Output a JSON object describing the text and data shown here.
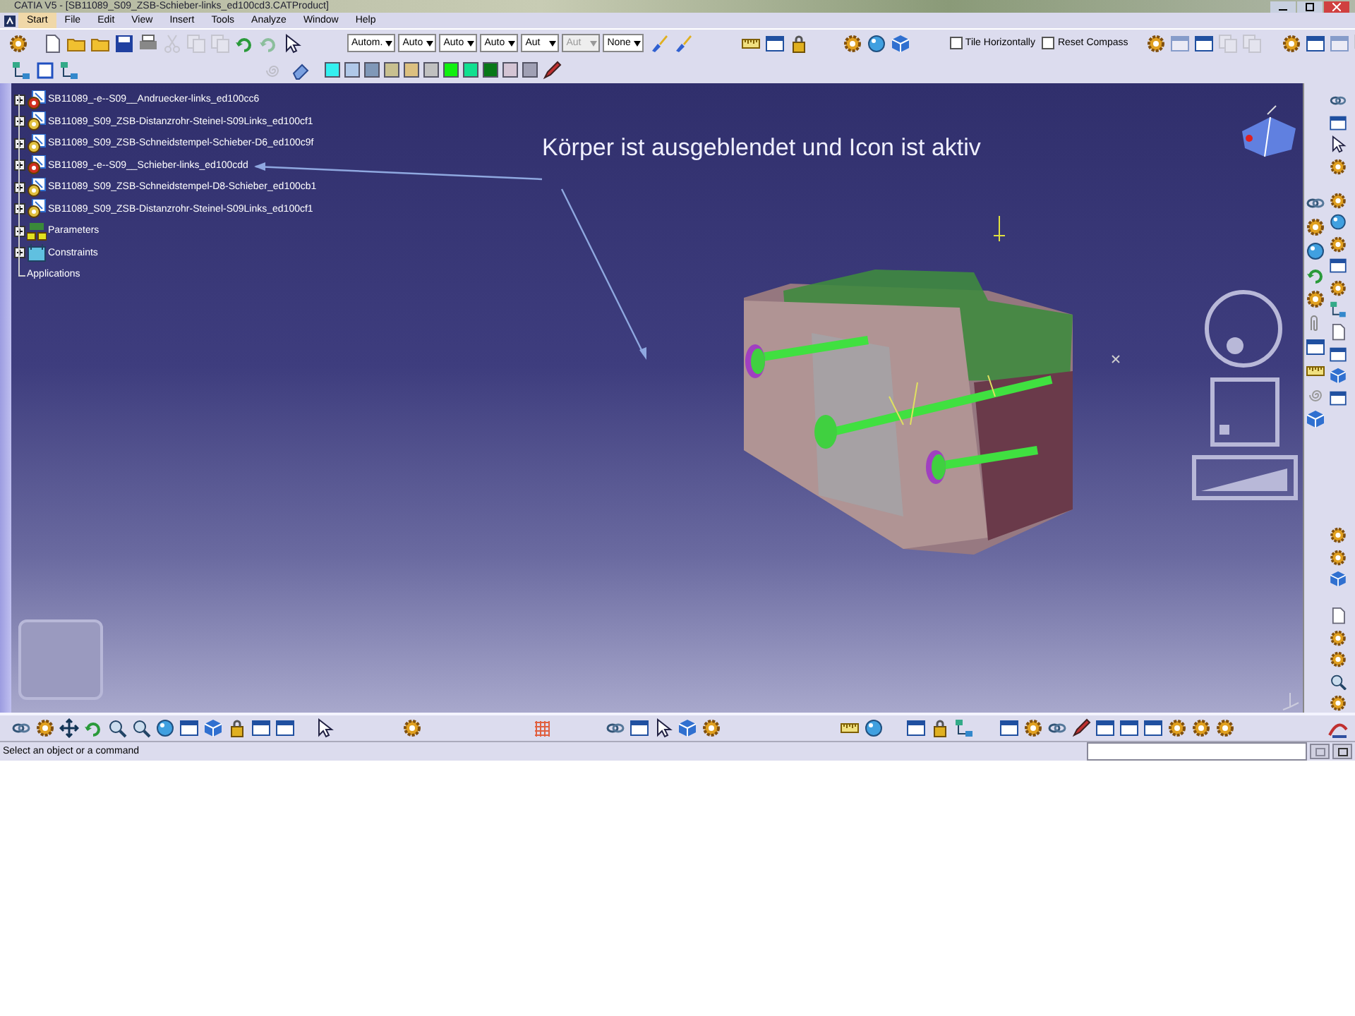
{
  "window": {
    "title": "CATIA V5 - [SB11089_S09_ZSB-Schieber-links_ed100cd3.CATProduct]"
  },
  "menu": [
    {
      "label": "Start",
      "selected": true
    },
    {
      "label": "File",
      "selected": false
    },
    {
      "label": "Edit",
      "selected": false
    },
    {
      "label": "View",
      "selected": false
    },
    {
      "label": "Insert",
      "selected": false
    },
    {
      "label": "Tools",
      "selected": false
    },
    {
      "label": "Analyze",
      "selected": false
    },
    {
      "label": "Window",
      "selected": false
    },
    {
      "label": "Help",
      "selected": false
    }
  ],
  "toolbar": {
    "dropdowns": [
      {
        "value": "Autom.",
        "disabled": false
      },
      {
        "value": "Auto",
        "disabled": false
      },
      {
        "value": "Auto",
        "disabled": false
      },
      {
        "value": "Auto",
        "disabled": false
      },
      {
        "value": "Aut",
        "disabled": false
      },
      {
        "value": "Aut",
        "disabled": true
      },
      {
        "value": "None",
        "disabled": false
      }
    ],
    "checkboxes": [
      {
        "label": "Tile Horizontally",
        "checked": false
      },
      {
        "label": "Reset Compass",
        "checked": false
      }
    ],
    "swatches": [
      {
        "color": "#33f0f0"
      },
      {
        "color": "#b0c8e8"
      },
      {
        "color": "#8098b8"
      },
      {
        "color": "#c8c090"
      },
      {
        "color": "#dcc080"
      },
      {
        "color": "#c0c0c0"
      },
      {
        "color": "#10f010"
      },
      {
        "color": "#10e090"
      },
      {
        "color": "#087818"
      },
      {
        "color": "#d4c4d4"
      },
      {
        "color": "#a0a0b4"
      }
    ]
  },
  "tree": {
    "items": [
      {
        "label": "SB11089_-e--S09__Andruecker-links_ed100cc6",
        "kind": "part",
        "expanded": false,
        "active": true
      },
      {
        "label": "SB11089_S09_ZSB-Distanzrohr-Steinel-S09Links_ed100cf1",
        "kind": "part",
        "expanded": false,
        "active": false
      },
      {
        "label": "SB11089_S09_ZSB-Schneidstempel-Schieber-D6_ed100c9f",
        "kind": "part",
        "expanded": false,
        "active": false
      },
      {
        "label": "SB11089_-e--S09__Schieber-links_ed100cdd",
        "kind": "part",
        "expanded": false,
        "active": true
      },
      {
        "label": "SB11089_S09_ZSB-Schneidstempel-D8-Schieber_ed100cb1",
        "kind": "part",
        "expanded": false,
        "active": false
      },
      {
        "label": "SB11089_S09_ZSB-Distanzrohr-Steinel-S09Links_ed100cf1",
        "kind": "part",
        "expanded": false,
        "active": false
      },
      {
        "label": "Parameters",
        "kind": "parameters",
        "expanded": false
      },
      {
        "label": "Constraints",
        "kind": "constraints",
        "expanded": false
      },
      {
        "label": "Applications",
        "kind": "applications"
      }
    ]
  },
  "annotation": "Körper ist ausgeblendet und Icon ist aktiv",
  "status_bar": {
    "message": "Select an object or a command"
  }
}
